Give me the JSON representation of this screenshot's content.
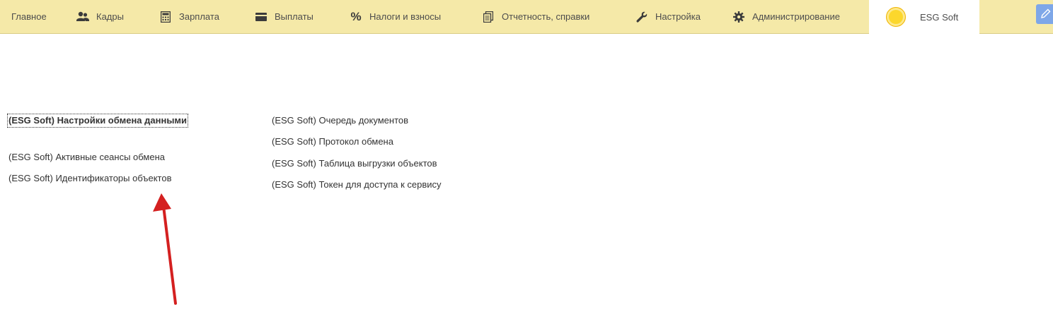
{
  "sections": [
    {
      "label": "Главное",
      "icon": "none"
    },
    {
      "label": "Кадры",
      "icon": "users-icon"
    },
    {
      "label": "Зарплата",
      "icon": "calculator-icon"
    },
    {
      "label": "Выплаты",
      "icon": "wallet-icon"
    },
    {
      "label": "Налоги и взносы",
      "icon": "percent-icon"
    },
    {
      "label": "Отчетность, справки",
      "icon": "documents-icon"
    },
    {
      "label": "Настройка",
      "icon": "wrench-icon"
    },
    {
      "label": "Администрирование",
      "icon": "gear-icon"
    },
    {
      "label": "ESG Soft",
      "icon": "sun-icon",
      "active": true
    }
  ],
  "edit_icon": "pencil-icon",
  "links": {
    "column1": [
      "(ESG Soft) Настройки обмена данными",
      "(ESG Soft) Активные сеансы обмена",
      "(ESG Soft) Идентификаторы объектов"
    ],
    "column2": [
      "(ESG Soft) Очередь документов",
      "(ESG Soft) Протокол обмена",
      "(ESG Soft) Таблица выгрузки объектов",
      "(ESG Soft) Токен для доступа к сервису"
    ]
  },
  "colors": {
    "topbar": "#f5e9a8",
    "active_tab": "#ffffff",
    "annotation_arrow": "#d42020",
    "edit_button": "#7ea7e8"
  }
}
